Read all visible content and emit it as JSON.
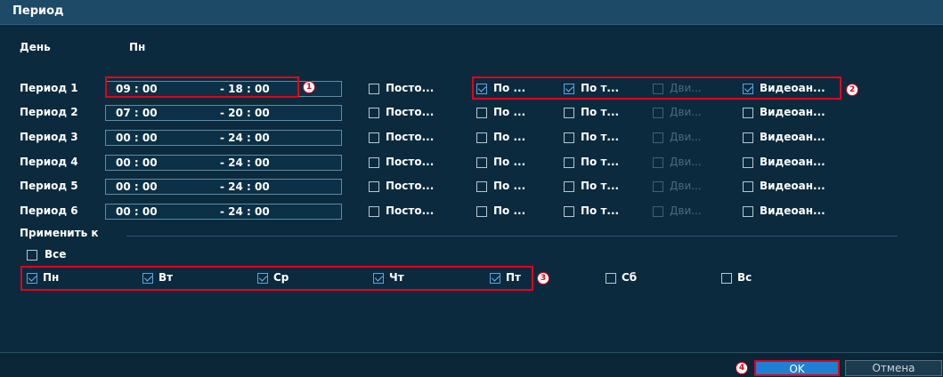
{
  "title": "Период",
  "day_label": "День",
  "day_value": "Пн",
  "column_labels": {
    "post": "Посто...",
    "po": "По ...",
    "pot": "По т...",
    "dvi": "Дви...",
    "video": "Видеоан..."
  },
  "periods": [
    {
      "label": "Период 1",
      "start": "09 : 00",
      "end": "- 18 : 00",
      "post": false,
      "po": true,
      "pot": true,
      "dvi": false,
      "video": true
    },
    {
      "label": "Период 2",
      "start": "07 : 00",
      "end": "- 20 : 00",
      "post": false,
      "po": false,
      "pot": false,
      "dvi": false,
      "video": false
    },
    {
      "label": "Период 3",
      "start": "00 : 00",
      "end": "- 24 : 00",
      "post": false,
      "po": false,
      "pot": false,
      "dvi": false,
      "video": false
    },
    {
      "label": "Период 4",
      "start": "00 : 00",
      "end": "- 24 : 00",
      "post": false,
      "po": false,
      "pot": false,
      "dvi": false,
      "video": false
    },
    {
      "label": "Период 5",
      "start": "00 : 00",
      "end": "- 24 : 00",
      "post": false,
      "po": false,
      "pot": false,
      "dvi": false,
      "video": false
    },
    {
      "label": "Период 6",
      "start": "00 : 00",
      "end": "- 24 : 00",
      "post": false,
      "po": false,
      "pot": false,
      "dvi": false,
      "video": false
    }
  ],
  "apply_to_label": "Применить к",
  "all_label": "Все",
  "all_checked": false,
  "days": [
    {
      "label": "Пн",
      "checked": true
    },
    {
      "label": "Вт",
      "checked": true
    },
    {
      "label": "Ср",
      "checked": true
    },
    {
      "label": "Чт",
      "checked": true
    },
    {
      "label": "Пт",
      "checked": true
    },
    {
      "label": "Сб",
      "checked": false
    },
    {
      "label": "Вс",
      "checked": false
    }
  ],
  "markers": [
    "1",
    "2",
    "3",
    "4"
  ],
  "buttons": {
    "ok": "OK",
    "cancel": "Отмена"
  },
  "colors": {
    "highlight": "#e3001b",
    "ok_button": "#1f7fd3",
    "background": "#0b2a3e"
  }
}
